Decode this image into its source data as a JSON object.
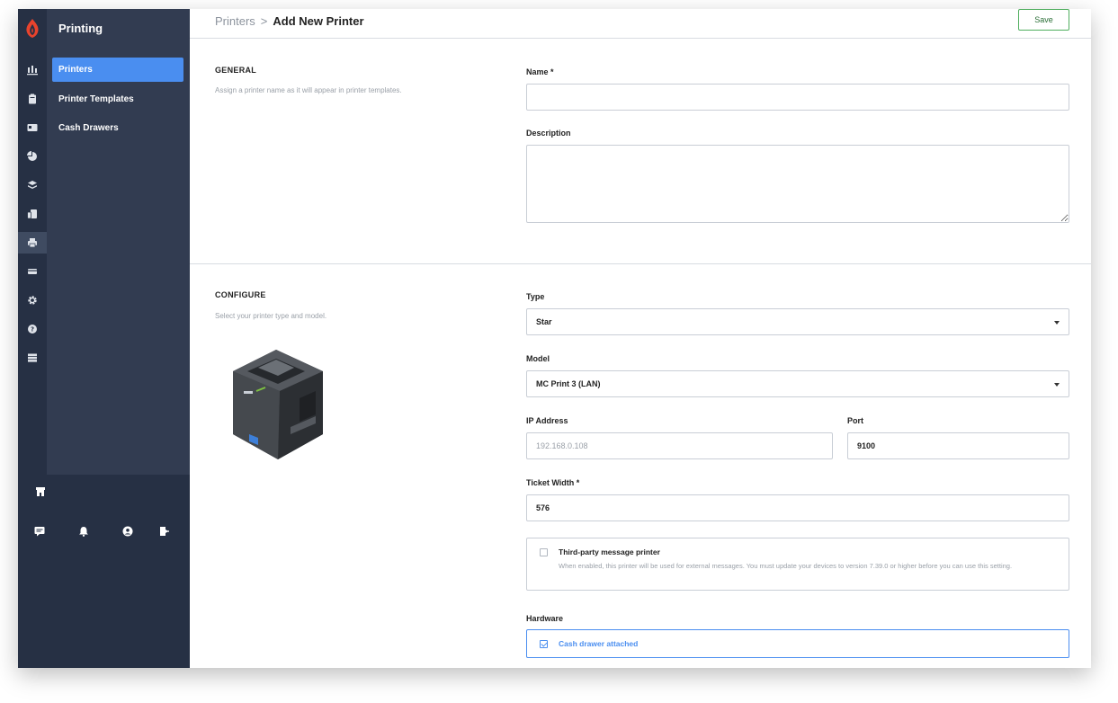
{
  "sidebar": {
    "title": "Printing",
    "items": [
      {
        "label": "Printers",
        "active": true
      },
      {
        "label": "Printer Templates",
        "active": false
      },
      {
        "label": "Cash Drawers",
        "active": false
      }
    ]
  },
  "rail_icons": [
    "reports-icon",
    "clipboard-icon",
    "id-card-icon",
    "pie-chart-icon",
    "layers-icon",
    "devices-icon",
    "printer-icon",
    "card-icon",
    "gear-icon",
    "help-icon",
    "server-icon"
  ],
  "bottom_icons": [
    "store-icon",
    "chat-icon",
    "bell-icon",
    "user-icon",
    "logout-icon"
  ],
  "header": {
    "breadcrumb_parent": "Printers",
    "breadcrumb_sep": ">",
    "breadcrumb_current": "Add New Printer",
    "save_label": "Save"
  },
  "general": {
    "heading": "GENERAL",
    "help": "Assign a printer name as it will appear in printer templates.",
    "name_label": "Name *",
    "name_value": "",
    "description_label": "Description",
    "description_value": ""
  },
  "configure": {
    "heading": "CONFIGURE",
    "help": "Select your printer type and model.",
    "type_label": "Type",
    "type_value": "Star",
    "model_label": "Model",
    "model_value": "MC Print 3 (LAN)",
    "ip_label": "IP Address",
    "ip_placeholder": "192.168.0.108",
    "port_label": "Port",
    "port_value": "9100",
    "ticket_width_label": "Ticket Width *",
    "ticket_width_value": "576",
    "third_party_title": "Third-party message printer",
    "third_party_desc": "When enabled, this printer will be used for external messages. You must update your devices to version 7.39.0 or higher before you can use this setting.",
    "third_party_checked": false,
    "hardware_label": "Hardware",
    "cash_drawer_label": "Cash drawer attached",
    "cash_drawer_checked": true
  },
  "colors": {
    "rail": "#263044",
    "sidebar": "#323c51",
    "accent": "#4a8ef0",
    "save_border": "#4fae5e",
    "logo": "#e8432d"
  }
}
